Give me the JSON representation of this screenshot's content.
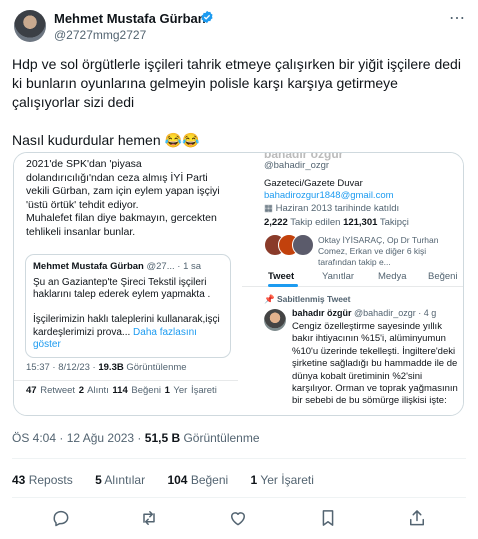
{
  "author": {
    "name": "Mehmet Mustafa Gürban",
    "handle": "@2727mmg2727"
  },
  "more_icon": "⋯",
  "tweet": {
    "paragraphs": [
      "Hdp ve sol örgütlerle işçileri tahrik etmeye çalışırken bir yiğit işçilere dedi ki bunların oyunlarına gelmeyin polisle karşı karşıya getirmeye çalışıyorlar sizi dedi",
      "Nasıl kudurdular hemen 😂😂"
    ]
  },
  "media_left": {
    "body": [
      "2021'de SPK'dan 'piyasa",
      "dolandırıcılığı'ndan ceza almış İYİ Parti",
      "vekili Gürban, zam için eylem yapan işçiyi",
      "'üstü örtük' tehdit ediyor.",
      "Muhalefet filan diye bakmayın,  gercekten",
      "tehlikeli insanlar bunlar."
    ],
    "quote": {
      "name": "Mehmet Mustafa Gürban",
      "handle_time": "@27... · 1 sa",
      "lines": [
        "Şu an Gaziantep'te Şireci Tekstil işçileri",
        "haklarını talep ederek eylem yapmakta .",
        "",
        "İşçilerimizin haklı taleplerini kullanarak,işçi",
        "kardeşlerimizi prova... "
      ],
      "more": "Daha fazlasını göster"
    },
    "time": "15:37 · 8/12/23 · ",
    "views_count": "19.3B",
    "views_label": " Görüntülenme",
    "retweets": "47",
    "retweets_label": " Retweet  ",
    "quotes": "2",
    "quotes_label": " Alıntı  ",
    "likes": "114",
    "likes_label": " Beğeni  ",
    "bookmarks": "1",
    "bookmarks_label": " Yer İşareti"
  },
  "media_right": {
    "name": "bahadır özgür",
    "handle": "@bahadir_ozgr",
    "bio": "Gazeteci/Gazete Duvar",
    "email": "bahadirozgur1848@gmail.com",
    "joined": "Haziran 2013 tarihinde katıldı",
    "following_count": "2,222",
    "following_label": " Takip edilen  ",
    "followers_count": "121,301",
    "followers_label": " Takipçi",
    "followed_by": "Oktay İYİSARAÇ, Op Dr Turhan Comez, Erkan ve diğer 6 kişi tarafından takip e...",
    "tabs": [
      "Tweet",
      "Yanıtlar",
      "Medya",
      "Beğeni"
    ],
    "pinned_label": "Sabitlenmiş Tweet",
    "post_name": "bahadır özgür",
    "post_handle_time": "@bahadir_ozgr · 4 g",
    "post_body": "Cengiz özelleştirme sayesinde yıllık bakır ihtiyacının %15'i, alüminyumun %10'u üzerinde tekelleşti. İngiltere'deki şirketine sağladığı bu hammadde ile de dünya kobalt üretiminin %2'sini karşılıyor. Orman ve toprak yağmasının bir sebebi de bu sömürge ilişkisi işte:"
  },
  "meta": {
    "time": "ÖS 4:04 · 12 Ağu 2023 · ",
    "views": "51,5 B",
    "views_label": " Görüntülenme"
  },
  "stats": {
    "reposts": "43",
    "reposts_label": " Reposts",
    "quotes": "5",
    "quotes_label": " Alıntılar",
    "likes": "104",
    "likes_label": " Beğeni",
    "bookmarks": "1",
    "bookmarks_label": " Yer İşareti"
  },
  "actions": [
    "reply-icon",
    "repost-icon",
    "like-icon",
    "bookmark-icon",
    "share-icon"
  ]
}
